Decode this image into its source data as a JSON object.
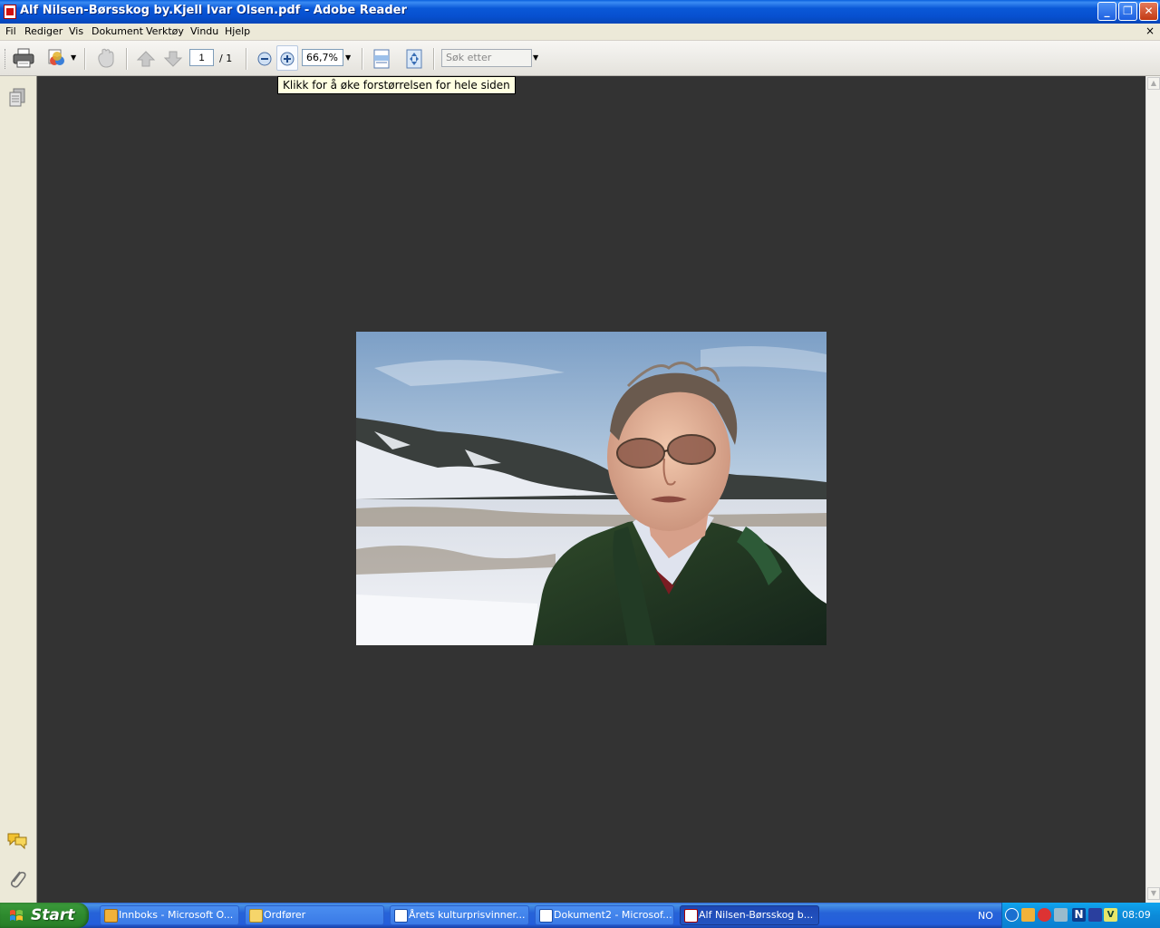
{
  "window": {
    "title": "Alf Nilsen-Børsskog by.Kjell Ivar Olsen.pdf - Adobe Reader",
    "minimize": "_",
    "maximize": "❐",
    "close": "✕"
  },
  "menu": {
    "items": [
      "Fil",
      "Rediger",
      "Vis",
      "Dokument",
      "Verktøy",
      "Vindu",
      "Hjelp"
    ],
    "close": "×"
  },
  "toolbar": {
    "page_current": "1",
    "page_total": "/ 1",
    "zoom_value": "66,7%",
    "search_placeholder": "Søk etter",
    "tooltip": "Klikk for å øke forstørrelsen for hele siden"
  },
  "taskbar": {
    "start_label": "Start",
    "tasks": [
      {
        "label": "Innboks - Microsoft O...",
        "icon": "outlook-icon"
      },
      {
        "label": "Ordfører",
        "icon": "folder-icon"
      },
      {
        "label": "Årets kulturprisvinner...",
        "icon": "word-icon"
      },
      {
        "label": "Dokument2 - Microsof...",
        "icon": "word-icon"
      },
      {
        "label": "Alf Nilsen-Børsskog b...",
        "icon": "adobe-reader-icon",
        "active": true
      }
    ],
    "language": "NO",
    "clock": "08:09"
  },
  "colors": {
    "doc_background": "#333333",
    "titlebar_blue": "#0a58d8",
    "start_green": "#2e8a2e"
  }
}
